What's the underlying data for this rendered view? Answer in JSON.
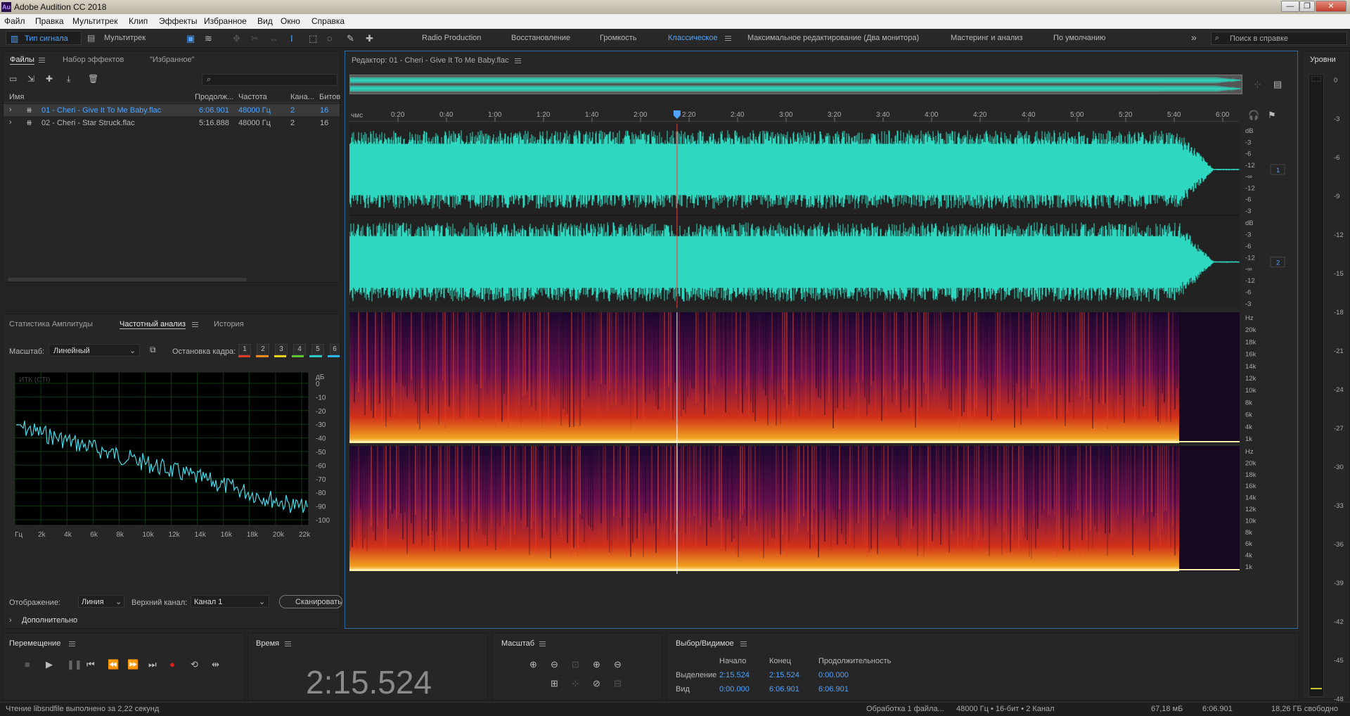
{
  "app": {
    "title": "Adobe Audition CC 2018",
    "logo": "Au"
  },
  "window_buttons": {
    "minimize": "—",
    "maximize": "❐",
    "close": "✕"
  },
  "menu": [
    "Файл",
    "Правка",
    "Мультитрек",
    "Клип",
    "Эффекты",
    "Избранное",
    "Вид",
    "Окно",
    "Справка"
  ],
  "toolbar": {
    "waveform_mode": "Тип сигнала",
    "multitrack_mode": "Мультитрек",
    "workspaces": [
      "Radio Production",
      "Восстановление",
      "Громкость",
      "Классическое",
      "Максимальное редактирование (Два монитора)",
      "Мастеринг и анализ",
      "По умолчанию"
    ],
    "active_workspace": "Классическое",
    "more": "»",
    "search_placeholder": "Поиск в справке"
  },
  "files_panel": {
    "tabs": [
      "Файлы",
      "Набор эффектов",
      "\"Избранное\""
    ],
    "columns": [
      "Имя",
      "Продолж...",
      "Частота",
      "Кана...",
      "Битов"
    ],
    "rows": [
      {
        "name": "01 - Cheri - Give It To Me Baby.flac",
        "duration": "6:06.901",
        "rate": "48000 Гц",
        "channels": "2",
        "bits": "16",
        "selected": true
      },
      {
        "name": "02 - Cheri - Star Struck.flac",
        "duration": "5:16.888",
        "rate": "48000 Гц",
        "channels": "2",
        "bits": "16",
        "selected": false
      }
    ]
  },
  "analysis_panel": {
    "tabs": [
      "Статистика Амплитуды",
      "Частотный анализ",
      "История"
    ],
    "scale_label": "Масштаб:",
    "scale_value": "Линейный",
    "freeze_label": "Остановка кадра:",
    "freeze_buttons": [
      "1",
      "2",
      "3",
      "4",
      "5",
      "6"
    ],
    "freeze_colors": [
      "#e03a2a",
      "#e88a1e",
      "#e8d21e",
      "#5ac82c",
      "#2cc8c8",
      "#2ab4e8"
    ],
    "graph_label": "ИТК (СТІ)",
    "db_unit": "дБ",
    "db_ticks": [
      "0",
      "-10",
      "-20",
      "-30",
      "-40",
      "-50",
      "-60",
      "-70",
      "-80",
      "-90",
      "-100"
    ],
    "hz_ticks": [
      "Гц",
      "2k",
      "4k",
      "6k",
      "8k",
      "10k",
      "12k",
      "14k",
      "16k",
      "18k",
      "20k",
      "22k"
    ],
    "display_label": "Отображение:",
    "display_value": "Линия",
    "channel_label": "Верхний канал:",
    "channel_value": "Канал 1",
    "scan_button": "Сканировать",
    "advanced": "Дополнительно"
  },
  "editor": {
    "title": "Редактор: 01 - Cheri - Give It To Me Baby.flac",
    "time_unit": "чмс",
    "time_ticks": [
      "0:20",
      "0:40",
      "1:00",
      "1:20",
      "1:40",
      "2:00",
      "2:20",
      "2:40",
      "3:00",
      "3:20",
      "3:40",
      "4:00",
      "4:20",
      "4:40",
      "5:00",
      "5:20",
      "5:40",
      "6:00"
    ],
    "playhead_fraction": 0.368,
    "db_scale": [
      "dB",
      "-3",
      "-6",
      "-12",
      "-∞",
      "-12",
      "-6",
      "-3"
    ],
    "hz_scale": [
      "Hz",
      "20k",
      "18k",
      "16k",
      "14k",
      "12k",
      "10k",
      "8k",
      "6k",
      "4k",
      "1k"
    ],
    "channel_1": "1",
    "channel_2": "2",
    "waveform_color": "#2ed8c0"
  },
  "levels_panel": {
    "title": "Уровни",
    "ticks": [
      "0",
      "-3",
      "-6",
      "-9",
      "-12",
      "-15",
      "-18",
      "-21",
      "-24",
      "-27",
      "-30",
      "-33",
      "-36",
      "-39",
      "-42",
      "-45",
      "-48"
    ]
  },
  "transport": {
    "title": "Перемещение"
  },
  "time_panel": {
    "title": "Время",
    "value": "2:15.524"
  },
  "zoom_panel": {
    "title": "Масштаб"
  },
  "selection_panel": {
    "title": "Выбор/Видимое",
    "cols": [
      "Начало",
      "Конец",
      "Продолжительность"
    ],
    "rows": [
      {
        "label": "Выделение",
        "start": "2:15.524",
        "end": "2:15.524",
        "dur": "0:00.000"
      },
      {
        "label": "Вид",
        "start": "0:00.000",
        "end": "6:06.901",
        "dur": "6:06.901"
      }
    ]
  },
  "status": {
    "left": "Чтение libsndfile выполнено за 2,22 секунд",
    "processing": "Обработка 1 файла...",
    "format": "48000 Гц • 16-бит • 2 Канал",
    "size": "67,18 мБ",
    "duration": "6:06.901",
    "free": "18,26 ГБ свободно"
  }
}
